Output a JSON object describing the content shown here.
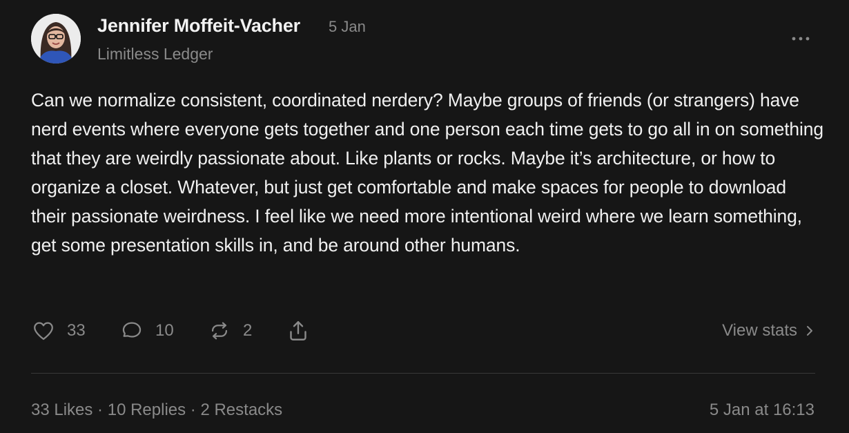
{
  "post": {
    "author": "Jennifer Moffeit-Vacher",
    "date": "5 Jan",
    "publication": "Limitless Ledger",
    "body": "Can we normalize consistent, coordinated nerdery? Maybe groups of friends (or strangers) have nerd events where everyone gets together and one person each time gets to go all in on something that they are weirdly passionate about. Like plants or rocks. Maybe it’s architecture, or how to organize a closet. Whatever, but just get comfortable and make spaces for people to download their passionate weirdness. I feel like we need more intentional weird where we learn something, get some presentation skills in, and be around other humans."
  },
  "actions": {
    "likes": "33",
    "replies": "10",
    "restacks": "2",
    "view_stats": "View stats"
  },
  "footer": {
    "likes": "33 Likes",
    "sep1": " · ",
    "replies": "10 Replies",
    "sep2": " · ",
    "restacks": "2 Restacks",
    "timestamp": "5 Jan at 16:13"
  },
  "icons": {
    "like": "heart-icon",
    "reply": "comment-icon",
    "restack": "restack-icon",
    "share": "share-icon",
    "more": "more-dots-icon",
    "chevron": "chevron-right-icon"
  },
  "colors": {
    "background": "#161616",
    "text": "#f2f2f2",
    "muted": "#8a8a8a",
    "divider": "#383838"
  }
}
